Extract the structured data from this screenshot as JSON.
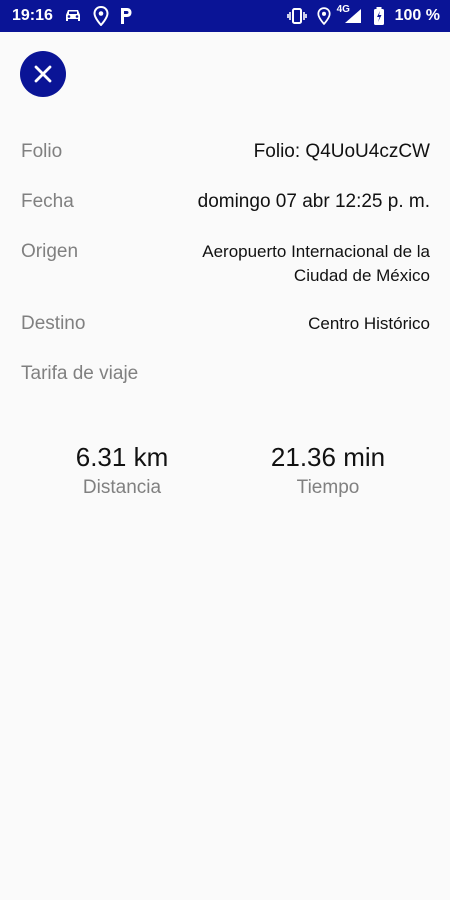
{
  "status_bar": {
    "time": "19:16",
    "network_label": "4G",
    "battery_text": "100 %"
  },
  "close_button": {
    "icon": "close-icon"
  },
  "details": {
    "folio": {
      "label": "Folio",
      "value": "Folio: Q4UoU4czCW"
    },
    "fecha": {
      "label": "Fecha",
      "value": "domingo 07 abr 12:25 p. m."
    },
    "origen": {
      "label": "Origen",
      "value": "Aeropuerto Internacional de la Ciudad de México"
    },
    "destino": {
      "label": "Destino",
      "value": "Centro Histórico"
    },
    "tarifa": {
      "label": "Tarifa de viaje",
      "value": ""
    }
  },
  "stats": {
    "distance": {
      "value": "6.31 km",
      "label": "Distancia"
    },
    "time": {
      "value": "21.36 min",
      "label": "Tiempo"
    }
  },
  "colors": {
    "primary": "#0a1496",
    "background": "#fafafa",
    "label": "#808080"
  }
}
